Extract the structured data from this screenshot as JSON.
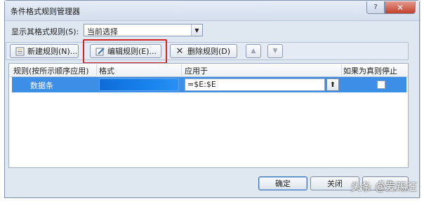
{
  "window": {
    "title": "条件格式规则管理器",
    "help_label": "?",
    "close_label": "✕"
  },
  "show_rules": {
    "label": "显示其格式规则(S):",
    "selected": "当前选择"
  },
  "toolbar": {
    "new_label": "新建规则(N)...",
    "edit_label": "编辑规则(E)...",
    "delete_label": "删除规则(D)",
    "up_icon": "arrow-up",
    "down_icon": "arrow-down"
  },
  "table": {
    "headers": [
      "规则(按所示顺序应用)",
      "格式",
      "应用于",
      "如果为真则停止"
    ],
    "rows": [
      {
        "rule": "数据条",
        "applies_to": "=$E:$E",
        "stop_if_true": false
      }
    ]
  },
  "buttons": {
    "ok": "确定",
    "close": "关闭",
    "apply": "应用"
  },
  "watermark": "头条 @爱踢汪",
  "colors": {
    "selection": "#3d8ee6",
    "databar": "#1a86f0",
    "highlight": "#d92320"
  }
}
